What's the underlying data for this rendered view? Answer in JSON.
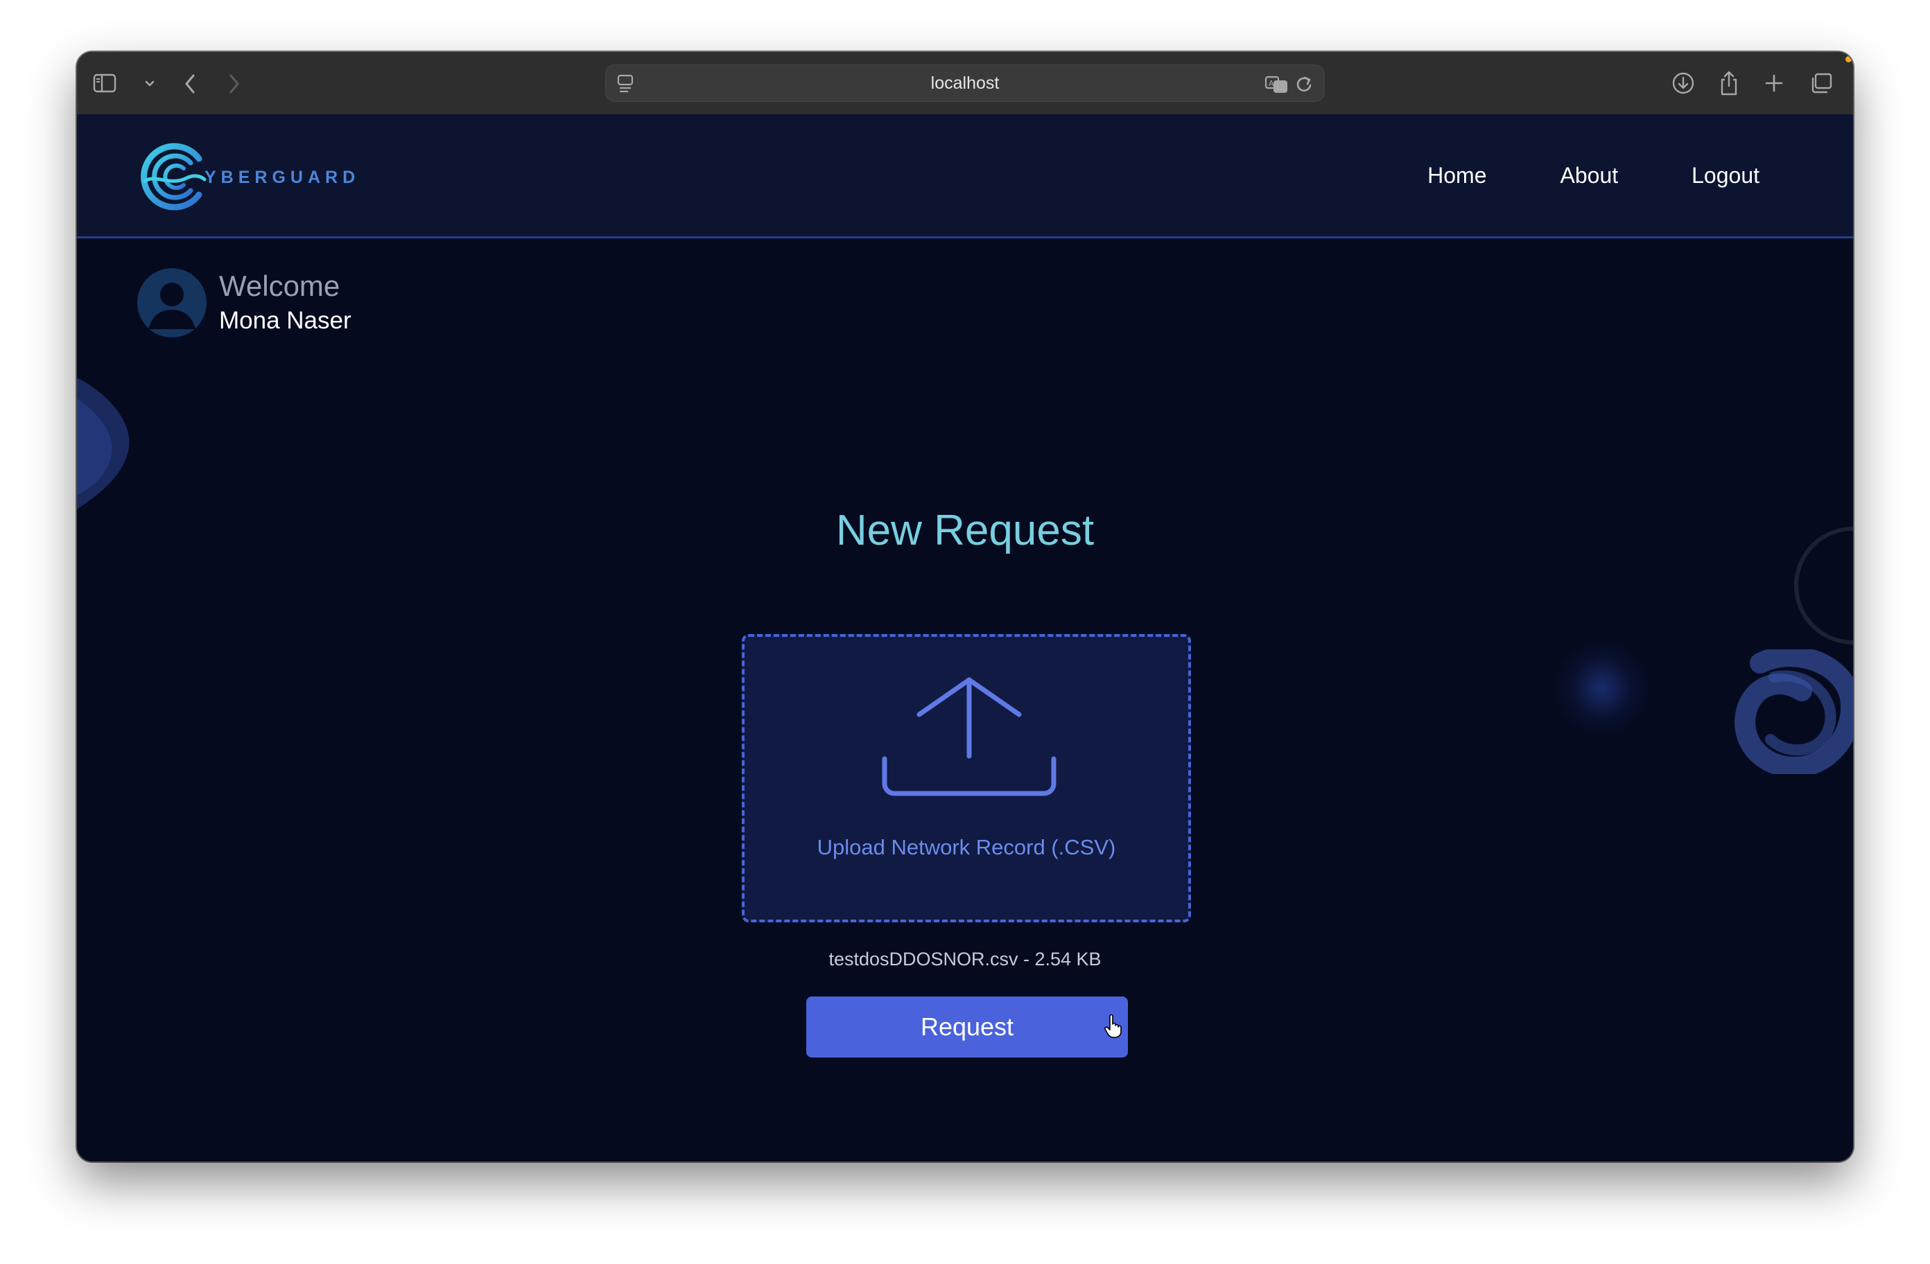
{
  "browser": {
    "url": "localhost",
    "icons": {
      "sidebar": "sidebar-icon",
      "sidebar_menu": "chevron-down-icon",
      "back": "chevron-left-icon",
      "forward": "chevron-right-icon",
      "page": "page-menu-icon",
      "translate": "translate-icon",
      "reload": "reload-icon",
      "downloads": "download-icon",
      "share": "share-icon",
      "new_tab": "plus-icon",
      "tabs": "tabs-overview-icon"
    }
  },
  "brand": {
    "logo_text": "YBERGUARD",
    "logo_letter": "C"
  },
  "nav": {
    "items": [
      {
        "label": "Home"
      },
      {
        "label": "About"
      },
      {
        "label": "Logout"
      }
    ]
  },
  "user": {
    "greeting": "Welcome",
    "name": "Mona Naser"
  },
  "main": {
    "title": "New Request",
    "upload_label": "Upload Network Record (.CSV)",
    "file_name": "testdosDDOSNOR.csv",
    "file_size": "2.54 KB",
    "file_info": "testdosDDOSNOR.csv - 2.54 KB",
    "submit_label": "Request"
  },
  "colors": {
    "page_background": "#050a1f",
    "navbar_background": "#0c1430",
    "title": "#78cfe0",
    "accent": "#4a63dc",
    "upload_text": "#6c8cec"
  }
}
